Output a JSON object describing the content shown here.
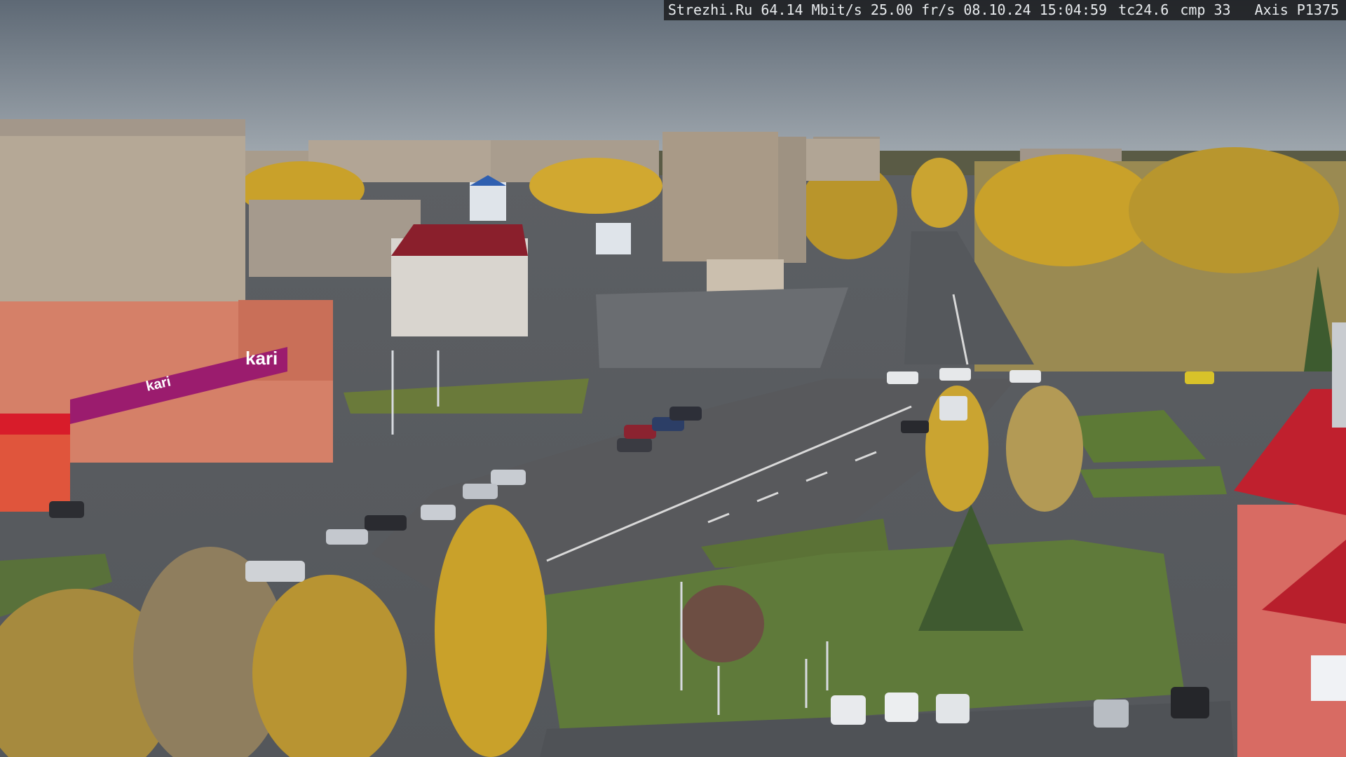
{
  "overlay": {
    "site": "Strezhi.Ru",
    "bitrate": "64.14 Mbit/s",
    "framerate": "25.00 fr/s",
    "date": "08.10.24",
    "time": "15:04:59",
    "tc": "tc24.6",
    "cmp": "cmp 33",
    "camera_model": "Axis P1375"
  },
  "scene": {
    "store_sign": "kari",
    "store_sign_secondary": "kari"
  },
  "colors": {
    "sky_top": "#5f6b77",
    "sky_bottom": "#9aa3ab",
    "asphalt": "#5d6064",
    "grass": "#5f7a3a",
    "autumn_yellow": "#c9a12a",
    "brand_magenta": "#9b1c6e",
    "roof_red": "#b3202d",
    "building_beige": "#b9aa98"
  }
}
